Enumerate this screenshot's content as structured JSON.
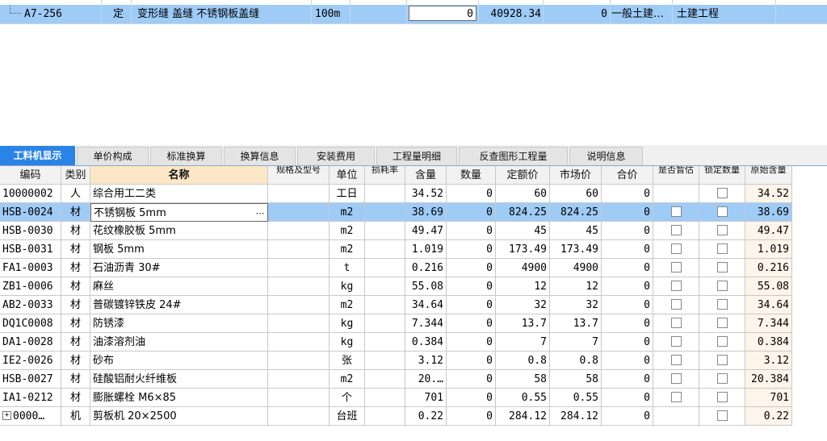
{
  "top_row": {
    "code": "A7-256",
    "type": "定",
    "name": "变形缝 盖缝 不锈钢板盖缝",
    "unit": "100m",
    "quantity": "0",
    "unit_price": "40928.34",
    "total": "0",
    "category": "一般土建…",
    "specialty": "土建工程"
  },
  "tabs": [
    {
      "label": "工料机显示",
      "active": true
    },
    {
      "label": "单价构成"
    },
    {
      "label": "标准换算"
    },
    {
      "label": "换算信息"
    },
    {
      "label": "安装费用"
    },
    {
      "label": "工程量明细"
    },
    {
      "label": "反查图形工程量"
    },
    {
      "label": "说明信息"
    }
  ],
  "columns": {
    "code": "编码",
    "type": "类别",
    "name": "名称",
    "spec": "规格及型号",
    "unit": "单位",
    "loss": "损耗率",
    "content": "含量",
    "qty": "数量",
    "quota_price": "定额价",
    "market_price": "市场价",
    "total": "合价",
    "estimated": "是否暂估",
    "locked_qty": "锁定数量",
    "orig_content": "原始含量"
  },
  "rows": [
    {
      "code": "10000002",
      "type": "人",
      "name": "综合用工二类",
      "unit": "工日",
      "content": "34.52",
      "qty": "0",
      "quota_price": "60",
      "market_price": "60",
      "total": "0",
      "has_estimated": false,
      "orig_content": "34.52"
    },
    {
      "code": "HSB-0024",
      "type": "材",
      "name": "不锈钢板 5mm",
      "unit": "m2",
      "content": "38.69",
      "qty": "0",
      "quota_price": "824.25",
      "market_price": "824.25",
      "total": "0",
      "has_estimated": true,
      "orig_content": "38.69",
      "selected": true
    },
    {
      "code": "HSB-0030",
      "type": "材",
      "name": "花纹橡胶板 5mm",
      "unit": "m2",
      "content": "49.47",
      "qty": "0",
      "quota_price": "45",
      "market_price": "45",
      "total": "0",
      "has_estimated": true,
      "orig_content": "49.47"
    },
    {
      "code": "HSB-0031",
      "type": "材",
      "name": "钢板 5mm",
      "unit": "m2",
      "content": "1.019",
      "qty": "0",
      "quota_price": "173.49",
      "market_price": "173.49",
      "total": "0",
      "has_estimated": true,
      "orig_content": "1.019"
    },
    {
      "code": "FA1-0003",
      "type": "材",
      "name": "石油沥青 30#",
      "unit": "t",
      "content": "0.216",
      "qty": "0",
      "quota_price": "4900",
      "market_price": "4900",
      "total": "0",
      "has_estimated": true,
      "orig_content": "0.216"
    },
    {
      "code": "ZB1-0006",
      "type": "材",
      "name": "麻丝",
      "unit": "kg",
      "content": "55.08",
      "qty": "0",
      "quota_price": "12",
      "market_price": "12",
      "total": "0",
      "has_estimated": true,
      "orig_content": "55.08"
    },
    {
      "code": "AB2-0033",
      "type": "材",
      "name": "普碳镀锌铁皮 24#",
      "unit": "m2",
      "content": "34.64",
      "qty": "0",
      "quota_price": "32",
      "market_price": "32",
      "total": "0",
      "has_estimated": true,
      "orig_content": "34.64"
    },
    {
      "code": "DQ1C0008",
      "type": "材",
      "name": "防锈漆",
      "unit": "kg",
      "content": "7.344",
      "qty": "0",
      "quota_price": "13.7",
      "market_price": "13.7",
      "total": "0",
      "has_estimated": true,
      "orig_content": "7.344"
    },
    {
      "code": "DA1-0028",
      "type": "材",
      "name": "油漆溶剂油",
      "unit": "kg",
      "content": "0.384",
      "qty": "0",
      "quota_price": "7",
      "market_price": "7",
      "total": "0",
      "has_estimated": true,
      "orig_content": "0.384"
    },
    {
      "code": "IE2-0026",
      "type": "材",
      "name": "砂布",
      "unit": "张",
      "content": "3.12",
      "qty": "0",
      "quota_price": "0.8",
      "market_price": "0.8",
      "total": "0",
      "has_estimated": true,
      "orig_content": "3.12"
    },
    {
      "code": "HSB-0027",
      "type": "材",
      "name": "硅酸铝耐火纤维板",
      "unit": "m2",
      "content": "20.…",
      "qty": "0",
      "quota_price": "58",
      "market_price": "58",
      "total": "0",
      "has_estimated": true,
      "orig_content": "20.384"
    },
    {
      "code": "IA1-0212",
      "type": "材",
      "name": "膨胀螺栓 M6×85",
      "unit": "个",
      "content": "701",
      "qty": "0",
      "quota_price": "0.55",
      "market_price": "0.55",
      "total": "0",
      "has_estimated": true,
      "orig_content": "701"
    },
    {
      "code": "0000…",
      "type": "机",
      "name": "剪板机 20×2500",
      "unit": "台班",
      "content": "0.22",
      "qty": "0",
      "quota_price": "284.12",
      "market_price": "284.12",
      "total": "0",
      "has_estimated": false,
      "orig_content": "0.22",
      "expandable": true
    }
  ],
  "icons": {
    "ellipsis": "ellipsis-icon",
    "expand": "plus-box-icon",
    "tree": "tree-guide-icon"
  }
}
